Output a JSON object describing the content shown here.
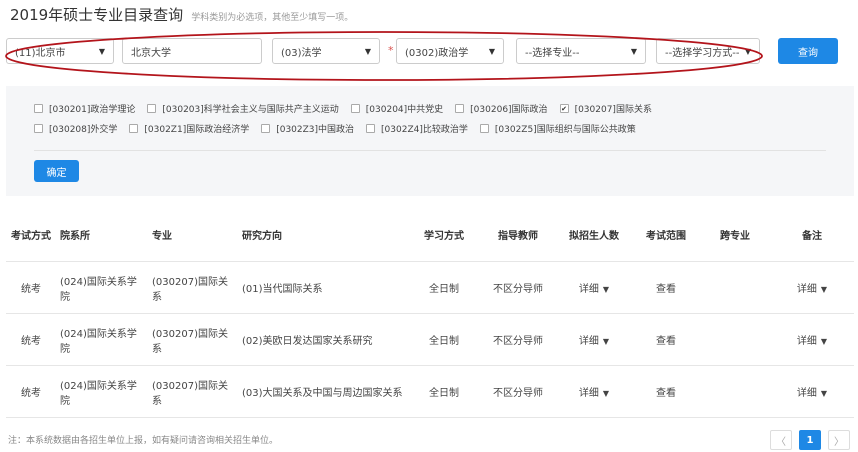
{
  "header": {
    "title": "2019年硕士专业目录查询",
    "subtitle": "学科类别为必选项，其他至少填写一项。"
  },
  "filters": {
    "province": "(11)北京市",
    "school": "北京大学",
    "category": "(03)法学",
    "required_mark": "*",
    "discipline": "(0302)政治学",
    "major": "--选择专业--",
    "study_mode": "--选择学习方式--",
    "query_label": "查询"
  },
  "subjects": {
    "row1": [
      {
        "label": "[030201]政治学理论",
        "checked": false
      },
      {
        "label": "[030203]科学社会主义与国际共产主义运动",
        "checked": false
      },
      {
        "label": "[030204]中共党史",
        "checked": false
      },
      {
        "label": "[030206]国际政治",
        "checked": false
      },
      {
        "label": "[030207]国际关系",
        "checked": true
      }
    ],
    "row2": [
      {
        "label": "[030208]外交学",
        "checked": false
      },
      {
        "label": "[0302Z1]国际政治经济学",
        "checked": false
      },
      {
        "label": "[0302Z3]中国政治",
        "checked": false
      },
      {
        "label": "[0302Z4]比较政治学",
        "checked": false
      },
      {
        "label": "[0302Z5]国际组织与国际公共政策",
        "checked": false
      }
    ],
    "check_glyph": "✔",
    "confirm_label": "确定"
  },
  "table": {
    "headers": {
      "exam_type": "考试方式",
      "department": "院系所",
      "major": "专业",
      "direction": "研究方向",
      "study_mode": "学习方式",
      "advisor": "指导教师",
      "enrollment": "拟招生人数",
      "exam_scope": "考试范围",
      "cross_major": "跨专业",
      "notes": "备注"
    },
    "rows": [
      {
        "exam_type": "统考",
        "department": "(024)国际关系学院",
        "major": "(030207)国际关系",
        "direction": "(01)当代国际关系",
        "study_mode": "全日制",
        "advisor": "不区分导师",
        "enrollment": "详细",
        "exam_scope": "查看",
        "cross_major": "",
        "notes": "详细"
      },
      {
        "exam_type": "统考",
        "department": "(024)国际关系学院",
        "major": "(030207)国际关系",
        "direction": "(02)美欧日发达国家关系研究",
        "study_mode": "全日制",
        "advisor": "不区分导师",
        "enrollment": "详细",
        "exam_scope": "查看",
        "cross_major": "",
        "notes": "详细"
      },
      {
        "exam_type": "统考",
        "department": "(024)国际关系学院",
        "major": "(030207)国际关系",
        "direction": "(03)大国关系及中国与周边国家关系",
        "study_mode": "全日制",
        "advisor": "不区分导师",
        "enrollment": "详细",
        "exam_scope": "查看",
        "cross_major": "",
        "notes": "详细"
      }
    ]
  },
  "footer": {
    "note": "注：本系统数据由各招生单位上报，如有疑问请咨询相关招生单位。",
    "prev": "〈",
    "page": "1",
    "next": "〉"
  },
  "icons": {
    "caret": "▼"
  },
  "colors": {
    "primary": "#1e88e5",
    "annotation_oval": "#b3141b",
    "required": "#d9534f"
  }
}
